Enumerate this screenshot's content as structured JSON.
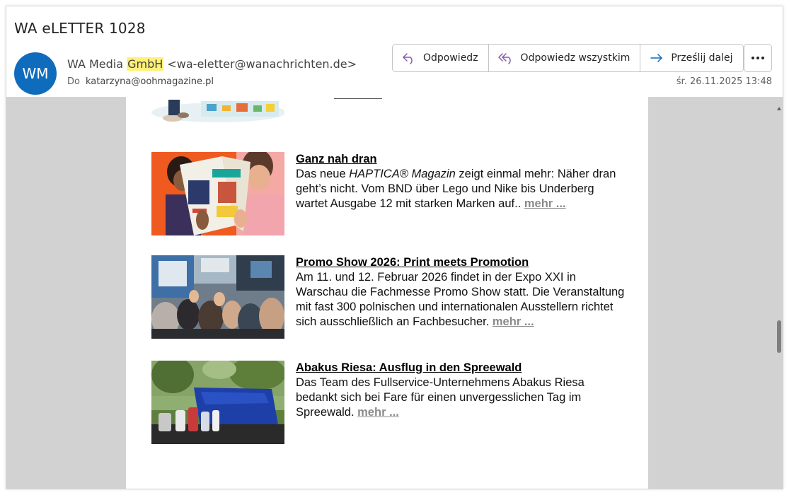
{
  "subject": "WA eLETTER 1028",
  "sender": {
    "initials": "WM",
    "name_pre": "WA Media ",
    "name_highlight": "GmbH",
    "email": " <wa-eletter@wanachrichten.de>",
    "to_label": "Do",
    "to_address": "katarzyna@oohmagazine.pl",
    "avatar_color": "#0f6cbd"
  },
  "actions": {
    "reply": "Odpowiedz",
    "reply_all": "Odpowiedz wszystkim",
    "forward": "Prześlij dalej"
  },
  "date": "śr. 26.11.2025 13:48",
  "articles": [
    {
      "title": "Ganz nah dran",
      "body_pre": "Das neue ",
      "body_em": "HAPTICA® Magazin",
      "body_post": " zeigt einmal mehr: Näher dran geht’s nicht. Vom BND über Lego und Nike bis Underberg wartet Ausgabe 12 mit starken Marken auf.. ",
      "more": "mehr ..."
    },
    {
      "title": "Promo Show 2026: Print meets Promotion",
      "body": "Am 11. und 12. Februar 2026 findet in der Expo XXI in Warschau die Fachmesse Promo Show statt. Die Veranstaltung mit fast 300 polnischen und internationalen Ausstellern richtet sich ausschließlich an Fachbesucher. ",
      "more": "mehr ..."
    },
    {
      "title": "Abakus Riesa: Ausflug in den Spreewald",
      "body": "Das Team des Fullservice-Unternehmens Abakus Riesa bedankt sich bei Fare für einen unvergesslichen Tag im Spreewald. ",
      "more": "mehr ..."
    }
  ]
}
